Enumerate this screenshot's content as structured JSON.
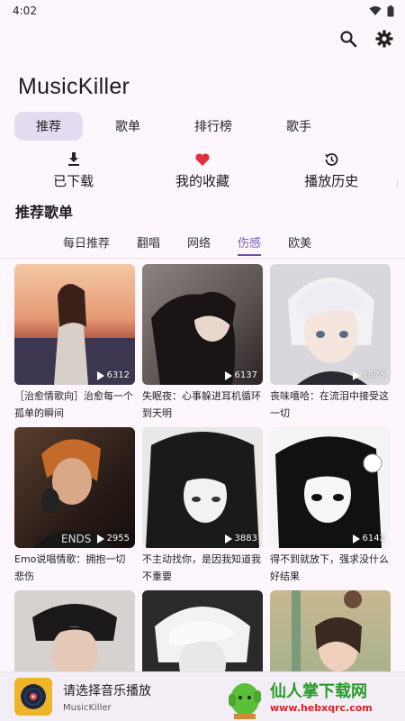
{
  "status": {
    "time": "4:02"
  },
  "app": {
    "title": "MusicKiller"
  },
  "tabs": [
    {
      "label": "推荐",
      "active": true
    },
    {
      "label": "歌单",
      "active": false
    },
    {
      "label": "排行榜",
      "active": false
    },
    {
      "label": "歌手",
      "active": false
    }
  ],
  "quick": [
    {
      "label": "已下载",
      "icon": "download-icon"
    },
    {
      "label": "我的收藏",
      "icon": "heart-icon"
    },
    {
      "label": "播放历史",
      "icon": "history-icon"
    }
  ],
  "section": {
    "title": "推荐歌单"
  },
  "categories": [
    {
      "label": "每日推荐",
      "active": false
    },
    {
      "label": "翻唱",
      "active": false
    },
    {
      "label": "网络",
      "active": false
    },
    {
      "label": "伤感",
      "active": true
    },
    {
      "label": "欧美",
      "active": false
    }
  ],
  "playlists": [
    {
      "title": "［治愈情歌向］治愈每一个孤单的瞬间",
      "plays": "6312",
      "color": "#d9826a"
    },
    {
      "title": "失眠夜：心事躲进耳机循环到天明",
      "plays": "6137",
      "color": "#6b6060"
    },
    {
      "title": "丧味嘻哈：在流泪中接受这一切",
      "plays": "1875",
      "color": "#b8b8bc"
    },
    {
      "title": "Emo说唱情歌：拥抱一切悲伤",
      "plays": "2955",
      "color": "#3a3030"
    },
    {
      "title": "不主动找你，是因我知道我不重要",
      "plays": "3883",
      "color": "#8a8a8a"
    },
    {
      "title": "得不到就放下，强求没什么好结果",
      "plays": "6142",
      "color": "#2c2c2c"
    },
    {
      "title": "",
      "plays": "",
      "color": "#4a4040"
    },
    {
      "title": "",
      "plays": "",
      "color": "#9a9a9a"
    },
    {
      "title": "",
      "plays": "",
      "color": "#c8b89a"
    }
  ],
  "player": {
    "title": "请选择音乐播放",
    "subtitle": "MusicKiller"
  },
  "watermark": {
    "name": "仙人掌下载网",
    "url": "www.hebxqrc.com"
  },
  "colors": {
    "accent": "#6b52a8",
    "heart": "#e0313a",
    "tab_active_bg": "#e3dbf0"
  }
}
